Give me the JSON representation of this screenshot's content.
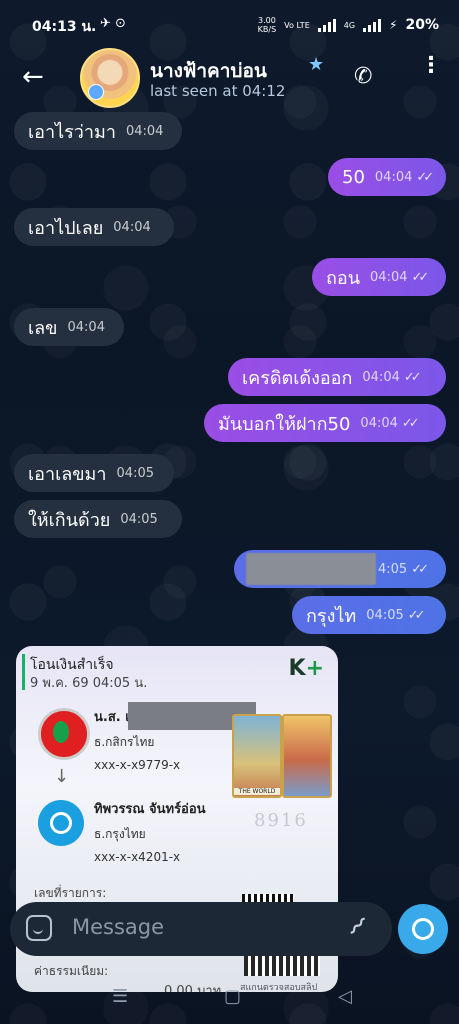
{
  "status_bar": {
    "time": "04:13 น.",
    "icons": "✈ ⊙",
    "speed_top": "3.00",
    "speed_bottom": "KB/S",
    "volte": "Vo LTE",
    "network": "4G",
    "battery": "20%"
  },
  "header": {
    "contact_name": "นางฟ้าคาบ่อน",
    "last_seen": "last seen at 04:12"
  },
  "messages": [
    {
      "direction": "in",
      "text": "เอาไรว่ามา",
      "time": "04:04"
    },
    {
      "direction": "out",
      "text": "50",
      "time": "04:04"
    },
    {
      "direction": "in",
      "text": "เอาไปเลย",
      "time": "04:04"
    },
    {
      "direction": "out",
      "text": "ถอน",
      "time": "04:04"
    },
    {
      "direction": "in",
      "text": "เลข",
      "time": "04:04"
    },
    {
      "direction": "out",
      "text": "เครดิตเด้งออก",
      "time": "04:04"
    },
    {
      "direction": "out",
      "text": "มันบอกให้ฝาก50",
      "time": "04:04"
    },
    {
      "direction": "in",
      "text": "เอาเลขมา",
      "time": "04:05"
    },
    {
      "direction": "in",
      "text": "ให้เกินด้วย",
      "time": "04:05"
    },
    {
      "direction": "out",
      "text": "",
      "time": "4:05"
    },
    {
      "direction": "out",
      "text": "กรุงไท",
      "time": "04:05"
    }
  ],
  "receipt": {
    "title": "โอนเงินสำเร็จ",
    "date": "9 พ.ค. 69  04:05 น.",
    "brand": "K",
    "brand_plus": "+",
    "sender_name": "น.ส. เม",
    "sender_bank": "ธ.กสิกรไทย",
    "sender_account": "xxx-x-x9779-x",
    "receiver_name": "ทิพวรรณ จันทร์อ่อน",
    "receiver_bank": "ธ.กรุงไทย",
    "receiver_account": "xxx-x-x4201-x",
    "code": "8916",
    "ref_label": "เลขที่รายการ:",
    "fee_label": "ค่าธรรมเนียม:",
    "fee_amount": "0.00 บาท",
    "verify_label": "สแกนตรวจสอบสลิป",
    "tarot_label": "THE WORLD"
  },
  "input": {
    "placeholder": "Message"
  },
  "colors": {
    "outgoing": "#8a52e8",
    "incoming": "#24303f",
    "camera": "#3aa9ea"
  }
}
